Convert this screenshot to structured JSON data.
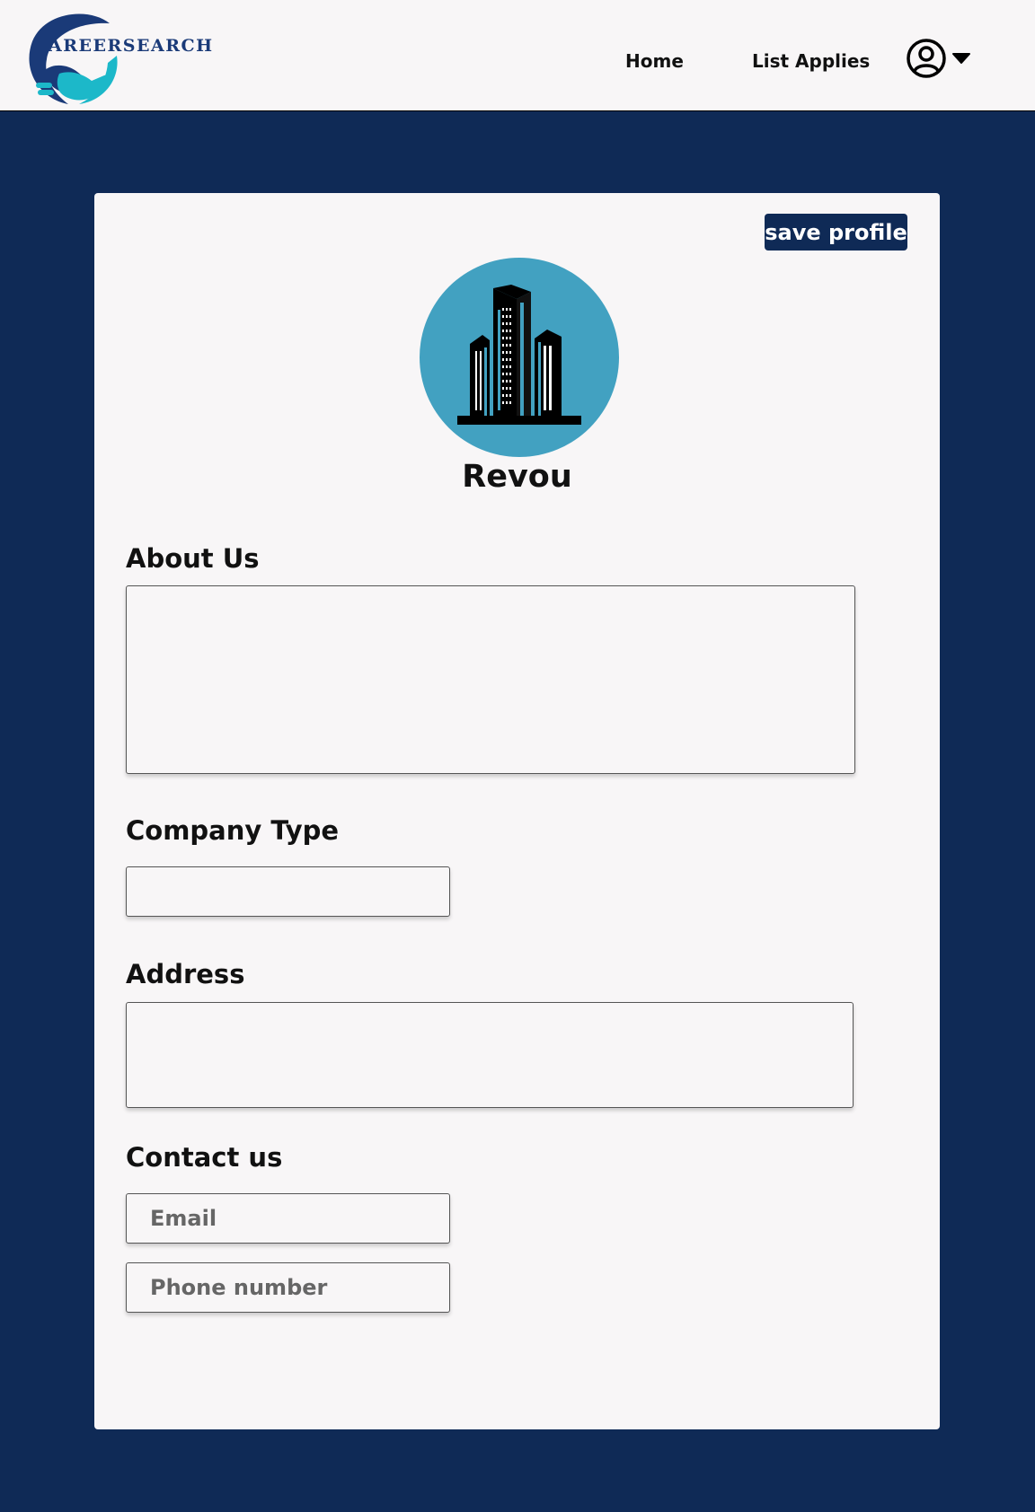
{
  "header": {
    "logo_text": "AREERSEARCH",
    "nav": {
      "home": "Home",
      "list_applies": "List Applies"
    },
    "icons": {
      "user": "user-circle-icon",
      "dropdown": "caret-down-icon"
    }
  },
  "profile": {
    "save_label": "save profile",
    "company_name": "Revou",
    "avatar_icon": "building-icon"
  },
  "form": {
    "about_label": "About Us",
    "about_value": "",
    "company_type_label": "Company Type",
    "company_type_value": "",
    "address_label": "Address",
    "address_value": "",
    "contact_label": "Contact us",
    "email_placeholder": "Email",
    "phone_placeholder": "Phone number"
  },
  "colors": {
    "page_background": "#0f2a56",
    "card_background": "#f8f6f7",
    "button_background": "#0f2a56",
    "avatar_background": "#42a1c1",
    "logo_primary": "#1a3a78",
    "logo_accent": "#1cb8c9"
  }
}
